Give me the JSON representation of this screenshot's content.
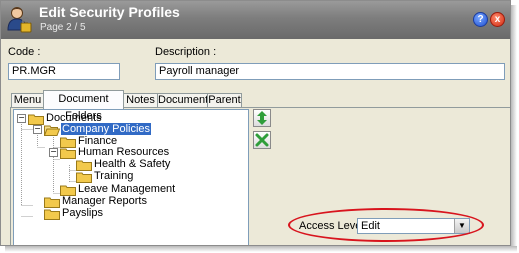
{
  "window": {
    "title": "Edit Security Profiles",
    "subtitle": "Page 2 / 5",
    "help_label": "?",
    "close_label": "x"
  },
  "form": {
    "code_label": "Code :",
    "code_value": "PR.MGR",
    "description_label": "Description :",
    "description_value": "Payroll manager"
  },
  "tabs": [
    {
      "label": "Menu"
    },
    {
      "label": "Document Folders",
      "active": true
    },
    {
      "label": "Notes"
    },
    {
      "label": "Documents"
    },
    {
      "label": "Parent"
    }
  ],
  "tree": [
    {
      "label": "Documents",
      "level": 0,
      "expanded": true
    },
    {
      "label": "Company Policies",
      "level": 1,
      "expanded": true,
      "selected": true
    },
    {
      "label": "Finance",
      "level": 2
    },
    {
      "label": "Human Resources",
      "level": 2,
      "expanded": true
    },
    {
      "label": "Health & Safety",
      "level": 3
    },
    {
      "label": "Training",
      "level": 3
    },
    {
      "label": "Leave Management",
      "level": 2
    },
    {
      "label": "Manager Reports",
      "level": 1
    },
    {
      "label": "Payslips",
      "level": 1
    }
  ],
  "access": {
    "label": "Access Level :",
    "value": "Edit"
  },
  "colors": {
    "highlight": "#d8141d",
    "selection": "#316ac5",
    "folder": "#f2c94c"
  },
  "icons": {
    "title": "user-lock-icon",
    "expand_collapse": "expand-collapse-arrows-icon",
    "remove": "remove-x-icon"
  }
}
